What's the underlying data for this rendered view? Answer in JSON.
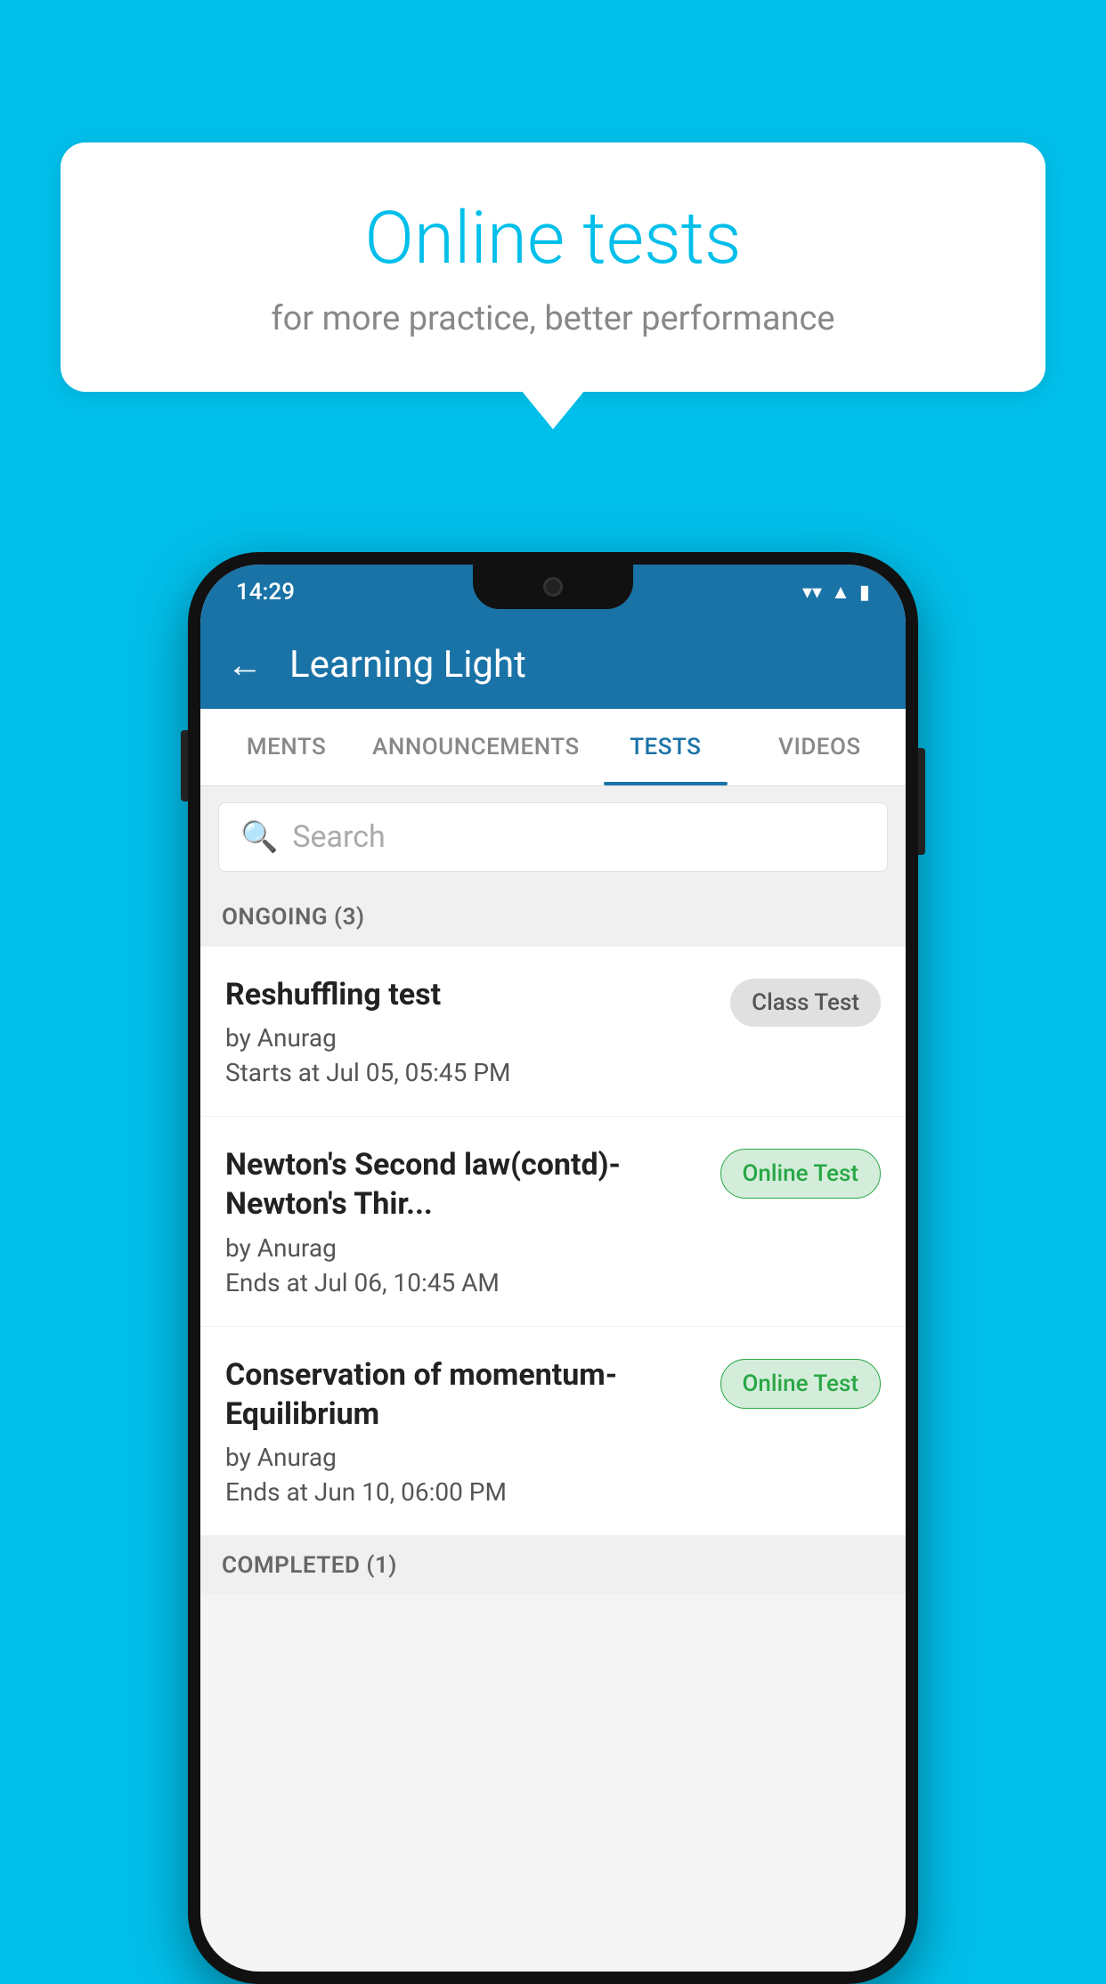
{
  "background_color": "#00BFEA",
  "speech_bubble": {
    "title": "Online tests",
    "subtitle": "for more practice, better performance"
  },
  "phone": {
    "status_bar": {
      "time": "14:29",
      "icons": [
        "wifi",
        "signal",
        "battery"
      ]
    },
    "header": {
      "title": "Learning Light",
      "back_label": "←"
    },
    "tabs": [
      {
        "label": "MENTS",
        "active": false
      },
      {
        "label": "ANNOUNCEMENTS",
        "active": false
      },
      {
        "label": "TESTS",
        "active": true
      },
      {
        "label": "VIDEOS",
        "active": false
      }
    ],
    "search": {
      "placeholder": "Search",
      "icon": "🔍"
    },
    "section_ongoing": {
      "label": "ONGOING (3)"
    },
    "tests_ongoing": [
      {
        "title": "Reshuffling test",
        "author": "by Anurag",
        "time_label": "Starts at  Jul 05, 05:45 PM",
        "badge": "Class Test",
        "badge_type": "class"
      },
      {
        "title": "Newton's Second law(contd)-Newton's Thir...",
        "author": "by Anurag",
        "time_label": "Ends at  Jul 06, 10:45 AM",
        "badge": "Online Test",
        "badge_type": "online"
      },
      {
        "title": "Conservation of momentum-Equilibrium",
        "author": "by Anurag",
        "time_label": "Ends at  Jun 10, 06:00 PM",
        "badge": "Online Test",
        "badge_type": "online"
      }
    ],
    "section_completed": {
      "label": "COMPLETED (1)"
    }
  }
}
